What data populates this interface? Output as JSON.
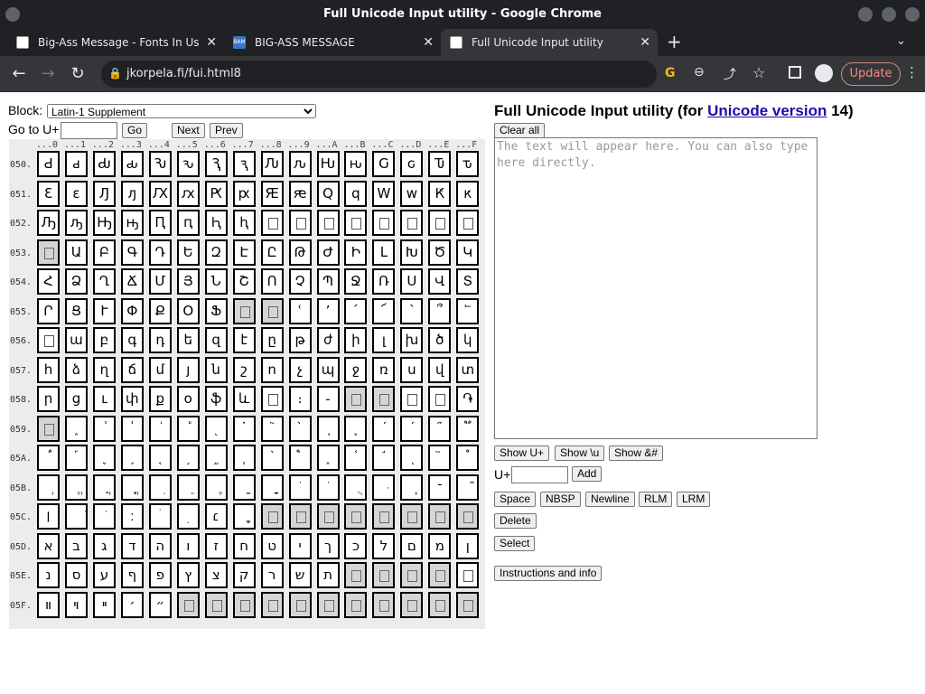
{
  "window": {
    "title": "Full Unicode Input utility - Google Chrome"
  },
  "tabs": [
    {
      "label": "Big-Ass Message - Fonts In Us",
      "favicon_color": "#d93025"
    },
    {
      "label": "BIG-ASS MESSAGE",
      "favicon_color": "#3b78c4",
      "favicon_text": "BAM"
    },
    {
      "label": "Full Unicode Input utility",
      "favicon_color": "#888"
    }
  ],
  "address": {
    "url": "jkorpela.fi/fui.html8",
    "update_label": "Update"
  },
  "page": {
    "block_label": "Block:",
    "block_value": "Latin-1 Supplement",
    "goto_label": "Go to U+",
    "go": "Go",
    "next": "Next",
    "prev": "Prev",
    "title_prefix": "Full Unicode Input utility (for ",
    "title_link": "Unicode version",
    "title_suffix": " 14)",
    "clear_all": "Clear all",
    "textarea_placeholder": "The text will appear here. You can also type here directly.",
    "show_u_plus": "Show U+",
    "show_backslash_u": "Show \\u",
    "show_entity": "Show &#",
    "add_prefix": "U+",
    "add": "Add",
    "space": "Space",
    "nbsp": "NBSP",
    "newline": "Newline",
    "rlm": "RLM",
    "lrm": "LRM",
    "delete": "Delete",
    "select": "Select",
    "instructions": "Instructions and info"
  },
  "grid": {
    "col_headers": [
      "...0",
      "...1",
      "...2",
      "...3",
      "...4",
      "...5",
      "...6",
      "...7",
      "...8",
      "...9",
      "...A",
      "...B",
      "...C",
      "...D",
      "...E",
      "...F"
    ],
    "rows": [
      {
        "label": "050.",
        "cells": [
          "Ԁ",
          "ԁ",
          "Ԃ",
          "ԃ",
          "Ԅ",
          "ԅ",
          "Ԇ",
          "ԇ",
          "Ԉ",
          "ԉ",
          "Ԋ",
          "ԋ",
          "Ԍ",
          "ԍ",
          "Ԏ",
          "ԏ"
        ]
      },
      {
        "label": "051.",
        "cells": [
          "Ԑ",
          "ԑ",
          "Ԓ",
          "ԓ",
          "Ԕ",
          "ԕ",
          "Ԗ",
          "ԗ",
          "Ԙ",
          "ԙ",
          "Ԛ",
          "ԛ",
          "Ԝ",
          "ԝ",
          "Ԟ",
          "ԟ"
        ]
      },
      {
        "label": "052.",
        "cells": [
          "Ԡ",
          "ԡ",
          "Ԣ",
          "ԣ",
          "Ԥ",
          "ԥ",
          "Ԧ",
          "ԧ",
          "[box]",
          "[box]",
          "[box]",
          "[box]",
          "[box]",
          "[box]",
          "[box]",
          "[box]"
        ]
      },
      {
        "label": "053.",
        "cells": [
          "[gray]",
          "Ա",
          "Բ",
          "Գ",
          "Դ",
          "Ե",
          "Զ",
          "Է",
          "Ը",
          "Թ",
          "Ժ",
          "Ի",
          "Լ",
          "Խ",
          "Ծ",
          "Կ"
        ]
      },
      {
        "label": "054.",
        "cells": [
          "Հ",
          "Ձ",
          "Ղ",
          "Ճ",
          "Մ",
          "Յ",
          "Ն",
          "Շ",
          "Ո",
          "Չ",
          "Պ",
          "Ջ",
          "Ռ",
          "Ս",
          "Վ",
          "Տ"
        ]
      },
      {
        "label": "055.",
        "cells": [
          "Ր",
          "Ց",
          "Ւ",
          "Փ",
          "Ք",
          "Օ",
          "Ֆ",
          "[gray]",
          "[gray]",
          "ՙ",
          "՚",
          "՛",
          "՜",
          "՝",
          "՞",
          "՟"
        ]
      },
      {
        "label": "056.",
        "cells": [
          "[box]",
          "ա",
          "բ",
          "գ",
          "դ",
          "ե",
          "զ",
          "է",
          "ը",
          "թ",
          "ժ",
          "ի",
          "լ",
          "խ",
          "ծ",
          "կ"
        ]
      },
      {
        "label": "057.",
        "cells": [
          "հ",
          "ձ",
          "ղ",
          "ճ",
          "մ",
          "յ",
          "ն",
          "շ",
          "ո",
          "չ",
          "պ",
          "ջ",
          "ռ",
          "ս",
          "վ",
          "տ"
        ]
      },
      {
        "label": "058.",
        "cells": [
          "ր",
          "ց",
          "ւ",
          "փ",
          "ք",
          "օ",
          "ֆ",
          "և",
          "[box]",
          "։",
          "֊",
          "[gray]",
          "[gray]",
          "[box]",
          "[box]",
          "֏"
        ]
      },
      {
        "label": "059.",
        "cells": [
          "[gray]",
          "֑",
          "֒",
          "֓",
          "֔",
          "֕",
          "֖",
          "֗",
          "֘",
          "֙",
          "֚",
          "֛",
          "֜",
          "֝",
          "֞",
          "֟"
        ]
      },
      {
        "label": "05A.",
        "cells": [
          "֠",
          "֡",
          "֢",
          "֣",
          "֤",
          "֥",
          "֦",
          "֧",
          "֨",
          "֩",
          "֪",
          "֫",
          "֬",
          "֭",
          "֮",
          "֯"
        ]
      },
      {
        "label": "05B.",
        "cells": [
          "ְ",
          "ֱ",
          "ֲ",
          "ֳ",
          "ִ",
          "ֵ",
          "ֶ",
          "ַ",
          "ָ",
          "ֹ",
          "ֺ",
          "ֻ",
          "ּ",
          "ֽ",
          "־",
          "ֿ"
        ]
      },
      {
        "label": "05C.",
        "cells": [
          "׀",
          "ׁ",
          "ׂ",
          "׃",
          "ׄ",
          "ׅ",
          "׆",
          "ׇ",
          "[gray]",
          "[gray]",
          "[gray]",
          "[gray]",
          "[gray]",
          "[gray]",
          "[gray]",
          "[gray]"
        ]
      },
      {
        "label": "05D.",
        "cells": [
          "א",
          "ב",
          "ג",
          "ד",
          "ה",
          "ו",
          "ז",
          "ח",
          "ט",
          "י",
          "ך",
          "כ",
          "ל",
          "ם",
          "מ",
          "ן"
        ]
      },
      {
        "label": "05E.",
        "cells": [
          "נ",
          "ס",
          "ע",
          "ף",
          "פ",
          "ץ",
          "צ",
          "ק",
          "ר",
          "ש",
          "ת",
          "[gray]",
          "[gray]",
          "[gray]",
          "[gray]",
          "[box]"
        ]
      },
      {
        "label": "05F.",
        "cells": [
          "װ",
          "ױ",
          "ײ",
          "׳",
          "״",
          "[gray]",
          "[gray]",
          "[gray]",
          "[gray]",
          "[gray]",
          "[gray]",
          "[gray]",
          "[gray]",
          "[gray]",
          "[gray]",
          "[gray]"
        ]
      }
    ]
  }
}
